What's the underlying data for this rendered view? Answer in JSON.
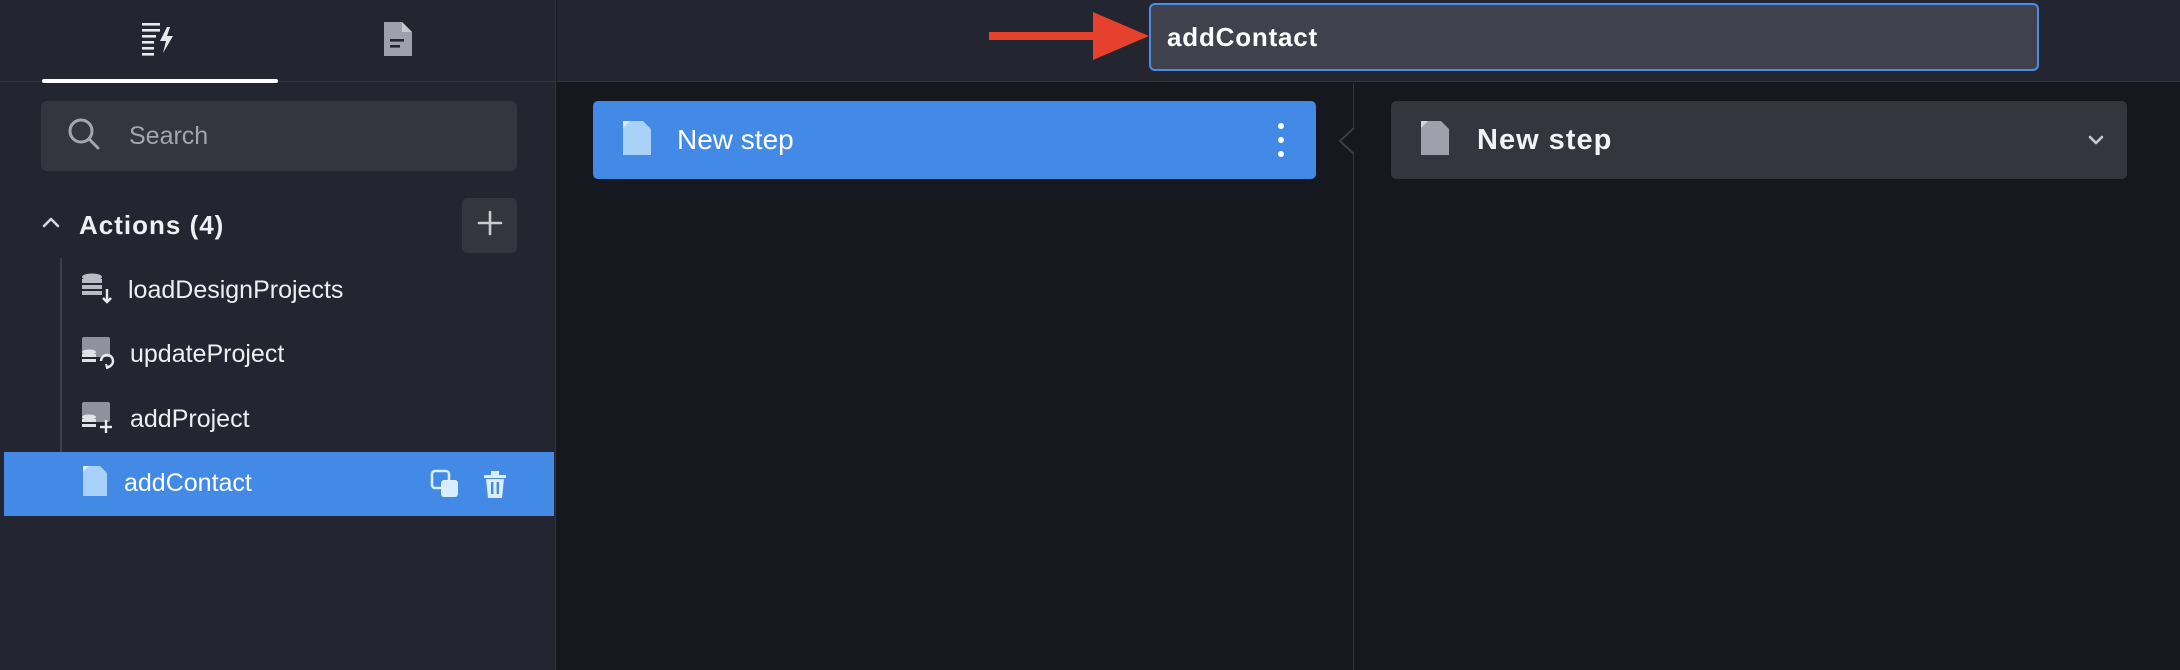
{
  "sidebar": {
    "tabs": [
      {
        "name": "actions-tab",
        "icon": "list-lightning-icon"
      },
      {
        "name": "document-tab",
        "icon": "document-icon"
      }
    ],
    "search": {
      "placeholder": "Search",
      "value": ""
    },
    "section": {
      "title": "Actions (4)",
      "add_icon": "plus-icon",
      "collapse_icon": "chevron-up-icon"
    },
    "actions": [
      {
        "label": "loadDesignProjects",
        "icon": "database-download-icon",
        "selected": false
      },
      {
        "label": "updateProject",
        "icon": "database-refresh-icon",
        "selected": false
      },
      {
        "label": "addProject",
        "icon": "database-add-icon",
        "selected": false
      },
      {
        "label": "addContact",
        "icon": "document-icon",
        "selected": true
      }
    ],
    "row_tools": {
      "duplicate_icon": "duplicate-icon",
      "delete_icon": "trash-icon"
    }
  },
  "toolbar": {
    "action_name_value": "addContact",
    "annotation_arrow_color": "#e5412d"
  },
  "steps": [
    {
      "label": "New step",
      "icon": "document-icon",
      "menu_icon": "more-vertical-icon"
    }
  ],
  "detail": {
    "title": "New step",
    "icon": "document-icon",
    "toggle_icon": "chevron-down-icon"
  },
  "colors": {
    "accent": "#4389e6",
    "sidebar_bg": "#232530",
    "canvas_bg": "#161820",
    "field_bg": "#33353f"
  }
}
